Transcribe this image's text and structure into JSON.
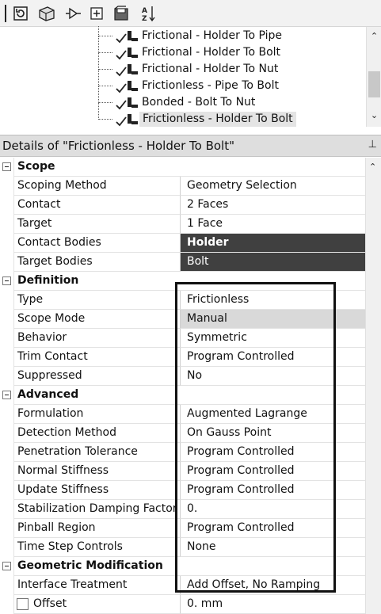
{
  "toolbar": {
    "buttons": [
      {
        "name": "refresh-icon",
        "glyph": "⟳"
      },
      {
        "name": "model-icon",
        "glyph": "◩"
      },
      {
        "name": "connection-icon",
        "glyph": "⊳"
      },
      {
        "name": "expand-all-icon",
        "glyph": "⊞"
      },
      {
        "name": "save-icon",
        "glyph": "▣"
      },
      {
        "name": "sort-icon",
        "glyph": "↓"
      }
    ]
  },
  "tree": {
    "items": [
      {
        "label": "Frictional - Holder To Pipe"
      },
      {
        "label": "Frictional - Holder To Bolt"
      },
      {
        "label": "Frictional - Holder To Nut"
      },
      {
        "label": "Frictionless - Pipe To Bolt"
      },
      {
        "label": "Bonded - Bolt To Nut"
      },
      {
        "label": "Frictionless - Holder To Bolt"
      }
    ]
  },
  "details": {
    "title": "Details of \"Frictionless - Holder To Bolt\"",
    "pin_glyph": "⊥"
  },
  "sections": {
    "scope": {
      "label": "Scope",
      "scoping_method": {
        "name": "Scoping Method",
        "value": "Geometry Selection"
      },
      "contact": {
        "name": "Contact",
        "value": "2 Faces"
      },
      "target": {
        "name": "Target",
        "value": "1 Face"
      },
      "contact_bodies": {
        "name": "Contact Bodies",
        "value": "Holder"
      },
      "target_bodies": {
        "name": "Target Bodies",
        "value": "Bolt"
      }
    },
    "definition": {
      "label": "Definition",
      "type": {
        "name": "Type",
        "value": "Frictionless"
      },
      "scope_mode": {
        "name": "Scope Mode",
        "value": "Manual"
      },
      "behavior": {
        "name": "Behavior",
        "value": "Symmetric"
      },
      "trim_contact": {
        "name": "Trim Contact",
        "value": "Program Controlled"
      },
      "suppressed": {
        "name": "Suppressed",
        "value": "No"
      }
    },
    "advanced": {
      "label": "Advanced",
      "formulation": {
        "name": "Formulation",
        "value": "Augmented Lagrange"
      },
      "detection_method": {
        "name": "Detection Method",
        "value": "On Gauss Point"
      },
      "penetration_tolerance": {
        "name": "Penetration Tolerance",
        "value": "Program Controlled"
      },
      "normal_stiffness": {
        "name": "Normal Stiffness",
        "value": "Program Controlled"
      },
      "update_stiffness": {
        "name": "Update Stiffness",
        "value": "Program Controlled"
      },
      "stabilization_damping": {
        "name": "Stabilization Damping Factor",
        "value": "0."
      },
      "pinball_region": {
        "name": "Pinball Region",
        "value": "Program Controlled"
      },
      "time_step_controls": {
        "name": "Time Step Controls",
        "value": "None"
      }
    },
    "geometric_modification": {
      "label": "Geometric Modification",
      "interface_treatment": {
        "name": "Interface Treatment",
        "value": "Add Offset, No Ramping"
      },
      "offset": {
        "name": "Offset",
        "value": "0. mm"
      }
    }
  },
  "colors": {
    "dark_cell": "#404040",
    "selected_cell": "#d9d9d9",
    "highlight_border": "#111111"
  }
}
